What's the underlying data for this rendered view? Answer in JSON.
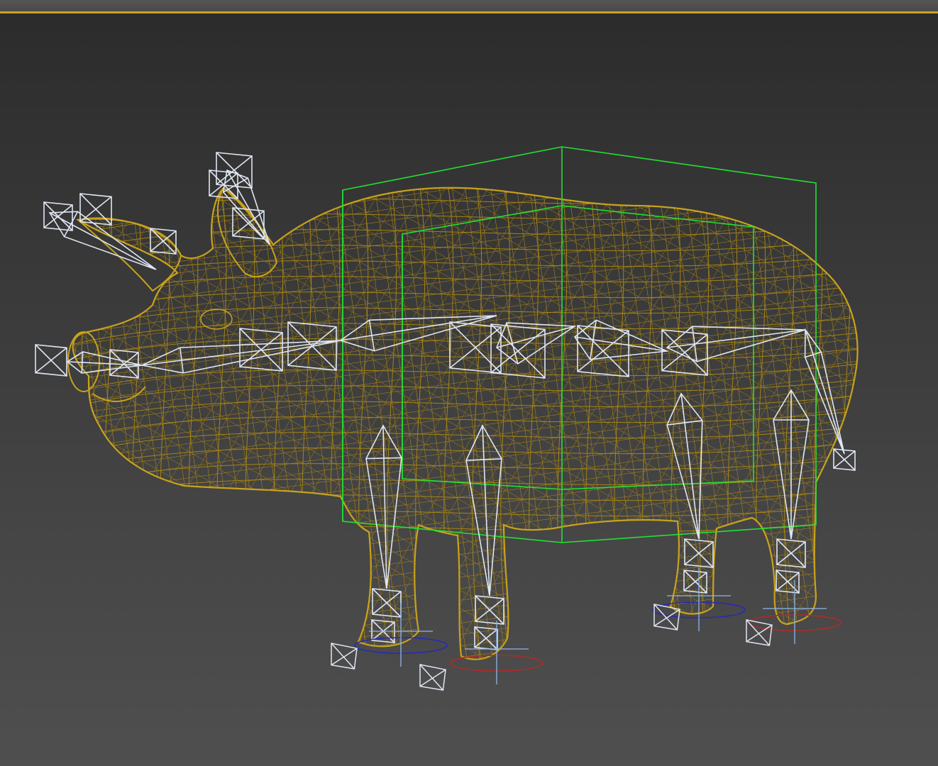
{
  "viewport": {
    "active_border_color": "#c8a52a",
    "background_top": "#2b2b2b",
    "background_bottom": "#4f4f4f"
  },
  "scene": {
    "mesh_color": "#b08a10",
    "mesh_highlight": "#c9a21c",
    "bone_color": "#dfe6f2",
    "bounding_box_color": "#22e033",
    "gizmo_axis_color": "#8fb6e6",
    "foot_ring_blue": "#2a2ab0",
    "foot_ring_red": "#b02a2a"
  },
  "icons": [
    "pig-mesh-icon",
    "bone-chain-icon",
    "bounding-box-icon",
    "foot-controller-icon"
  ]
}
